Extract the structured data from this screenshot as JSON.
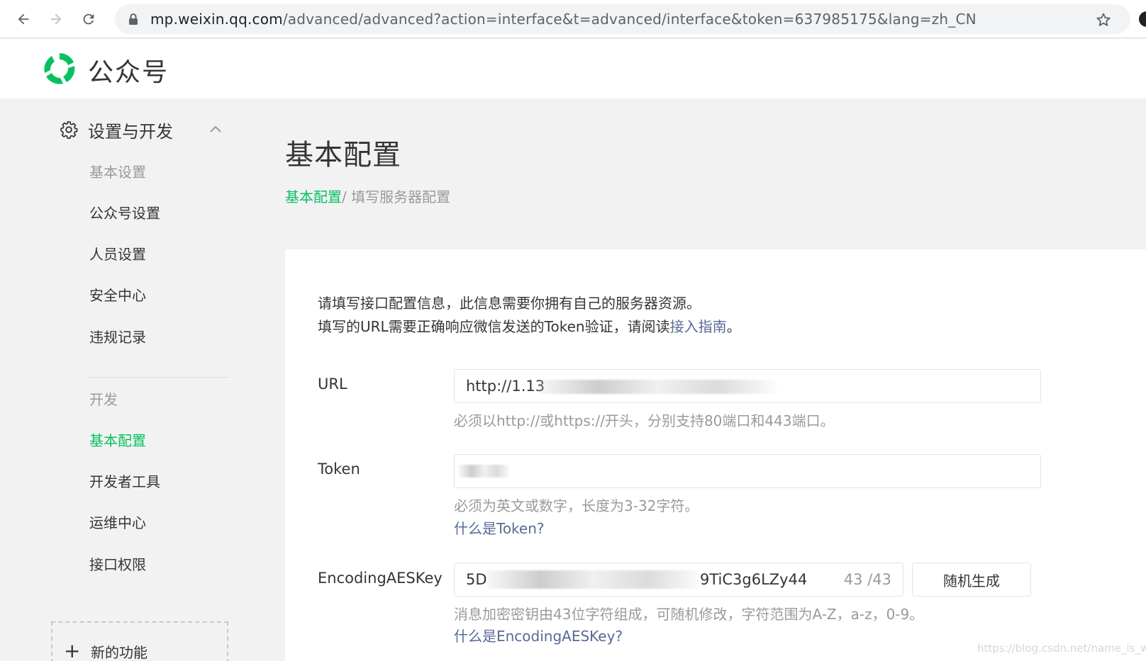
{
  "browser": {
    "url_host": "mp.weixin.qq.com",
    "url_path": "/advanced/advanced?action=interface&t=advanced/interface&token=637985175&lang=zh_CN"
  },
  "header": {
    "title": "公众号"
  },
  "sidebar": {
    "section1": {
      "label": "设置与开发"
    },
    "settings_items": [
      {
        "label": "基本设置"
      },
      {
        "label": "公众号设置"
      },
      {
        "label": "人员设置"
      },
      {
        "label": "安全中心"
      },
      {
        "label": "违规记录"
      }
    ],
    "dev_heading": "开发",
    "dev_items": [
      {
        "label": "基本配置"
      },
      {
        "label": "开发者工具"
      },
      {
        "label": "运维中心"
      },
      {
        "label": "接口权限"
      }
    ],
    "new_feature": "新的功能"
  },
  "main": {
    "title": "基本配置",
    "breadcrumb": {
      "link": "基本配置",
      "sep_current": "/ 填写服务器配置"
    },
    "intro": {
      "line1": "请填写接口配置信息，此信息需要你拥有自己的服务器资源。",
      "line2_pre": "填写的URL需要正确响应微信发送的Token验证，请阅读",
      "line2_link": "接入指南",
      "line2_post": "。"
    },
    "url_field": {
      "label": "URL",
      "value": "http://1.13",
      "hint": "必须以http://或https://开头，分别支持80端口和443端口。"
    },
    "token_field": {
      "label": "Token",
      "value": "",
      "hint": "必须为英文或数字，长度为3-32字符。",
      "help_link": "什么是Token?"
    },
    "aes_field": {
      "label": "EncodingAESKey",
      "value_start": "5D",
      "value_end": "9TiC3g6LZy44",
      "count": "43 /43",
      "generate_button": "随机生成",
      "hint": "消息加密密钥由43位字符组成，可随机修改，字符范围为A-Z，a-z，0-9。",
      "help_link": "什么是EncodingAESKey?"
    }
  },
  "watermark": "https://blog.csdn.net/name_is_wl"
}
